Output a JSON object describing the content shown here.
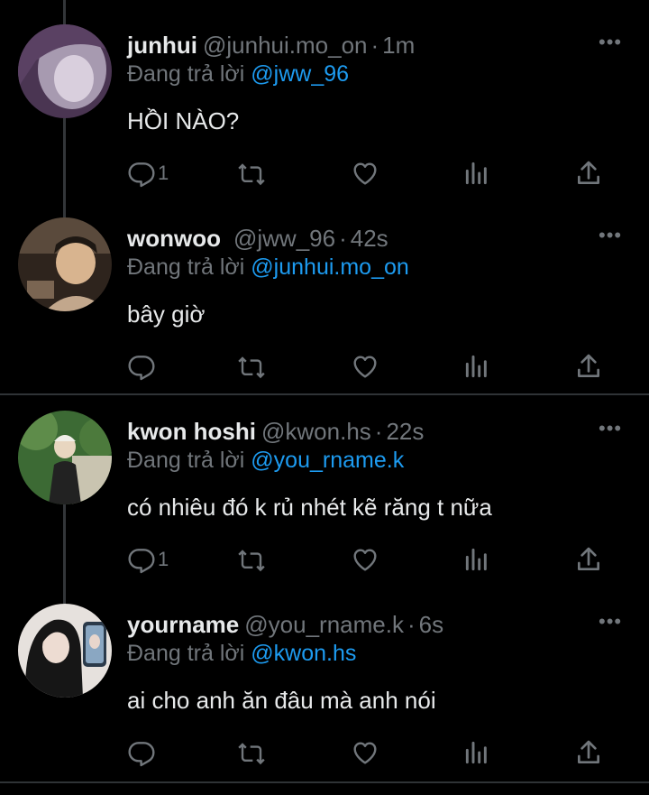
{
  "tweets": [
    {
      "name": "junhui",
      "handle": "@junhui.mo_on",
      "time": "1m",
      "reply_prefix": "Đang trả lời",
      "reply_to": "@jww_96",
      "text": "HỒI NÀO?",
      "reply_count": "1",
      "avatar_colors": [
        "#6b4a73",
        "#d8c7dd"
      ]
    },
    {
      "name": "wonwoo",
      "handle": "@jww_96",
      "time": "42s",
      "reply_prefix": "Đang trả lời",
      "reply_to": "@junhui.mo_on",
      "text": "bây giờ",
      "reply_count": "",
      "avatar_colors": [
        "#3b2f27",
        "#c9a27d"
      ]
    },
    {
      "name": "kwon hoshi",
      "handle": "@kwon.hs",
      "time": "22s",
      "reply_prefix": "Đang trả lời",
      "reply_to": "@you_rname.k",
      "text": "có nhiêu đó k rủ nhét kẽ răng t nữa",
      "reply_count": "1",
      "avatar_colors": [
        "#3f6b35",
        "#d9d4c2"
      ]
    },
    {
      "name": "yourname",
      "handle": "@you_rname.k",
      "time": "6s",
      "reply_prefix": "Đang trả lời",
      "reply_to": "@kwon.hs",
      "text": "ai cho anh ăn đâu mà anh nói",
      "reply_count": "",
      "avatar_colors": [
        "#1a1a1a",
        "#e8e3e0"
      ]
    }
  ],
  "ui": {
    "separator_dot": "·",
    "more_glyph": "•••"
  },
  "colors": {
    "background": "#000000",
    "text": "#e7e9ea",
    "muted": "#71767b",
    "accent": "#1d9bf0",
    "divider": "#2f3336"
  }
}
